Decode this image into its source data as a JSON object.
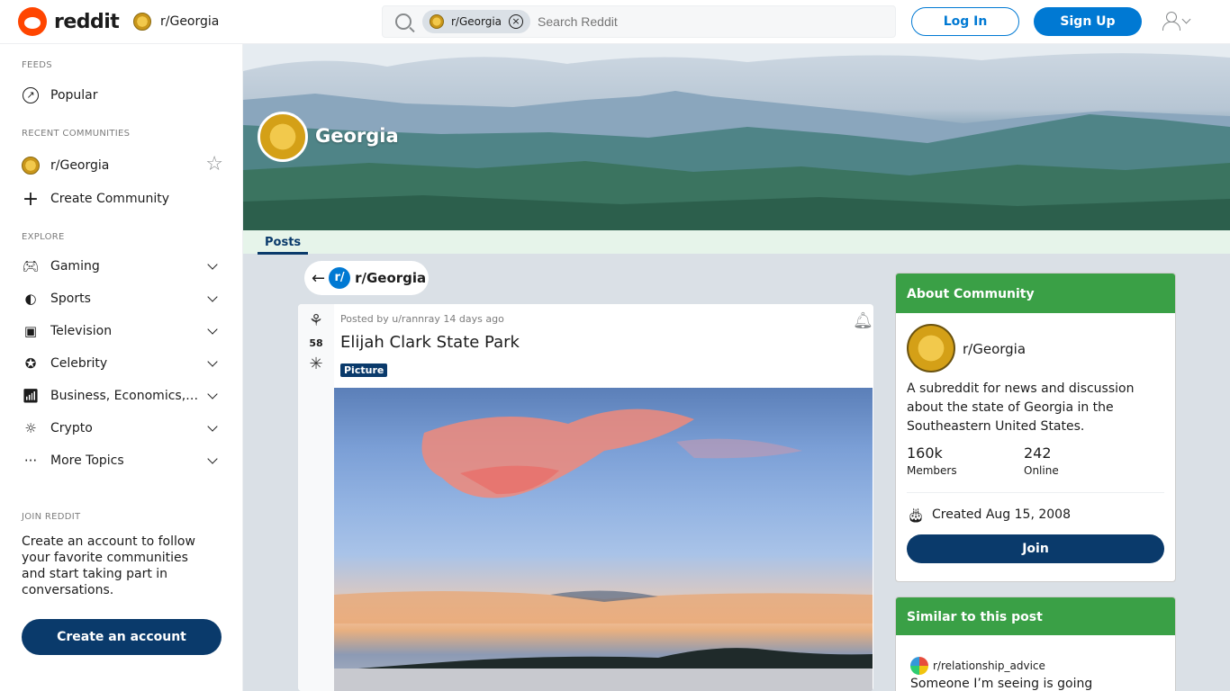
{
  "header": {
    "brand": "reddit",
    "subreddit": "r/Georgia",
    "search_chip": "r/Georgia",
    "search_placeholder": "Search Reddit",
    "login": "Log In",
    "signup": "Sign Up"
  },
  "sidebar": {
    "feeds_title": "FEEDS",
    "popular": "Popular",
    "recent_title": "RECENT COMMUNITIES",
    "recent_item": "r/Georgia",
    "create_community": "Create Community",
    "explore_title": "EXPLORE",
    "explore_items": [
      {
        "label": "Gaming",
        "icon": "gamepad-icon"
      },
      {
        "label": "Sports",
        "icon": "sports-icon"
      },
      {
        "label": "Television",
        "icon": "television-icon"
      },
      {
        "label": "Celebrity",
        "icon": "celebrity-icon"
      },
      {
        "label": "Business, Economics, and Finance",
        "icon": "business-icon"
      },
      {
        "label": "Crypto",
        "icon": "crypto-icon"
      },
      {
        "label": "More Topics",
        "icon": "more-icon"
      }
    ],
    "join_title": "JOIN REDDIT",
    "join_text": "Create an account to follow your favorite communities and start taking part in conversations.",
    "create_account": "Create an account"
  },
  "banner": {
    "title": "Georgia",
    "tab": "Posts"
  },
  "back": {
    "badge": "r/",
    "label": "r/Georgia"
  },
  "post": {
    "meta": "Posted by u/rannray 14 days ago",
    "votes": "58",
    "title": "Elijah Clark State Park",
    "flair": "Picture"
  },
  "about": {
    "header": "About Community",
    "name": "r/Georgia",
    "description": "A subreddit for news and discussion about the state of Georgia in the Southeastern United States.",
    "members_count": "160k",
    "members_label": "Members",
    "online_count": "242",
    "online_label": "Online",
    "created": "Created Aug 15, 2008",
    "join": "Join"
  },
  "similar": {
    "header": "Similar to this post",
    "subreddit": "r/relationship_advice",
    "title": "Someone I’m seeing is going"
  },
  "colors": {
    "accent_blue": "#0079d3",
    "dark_navy": "#0a3a6b",
    "community_green": "#3aa046",
    "reddit_orange": "#ff4500"
  }
}
